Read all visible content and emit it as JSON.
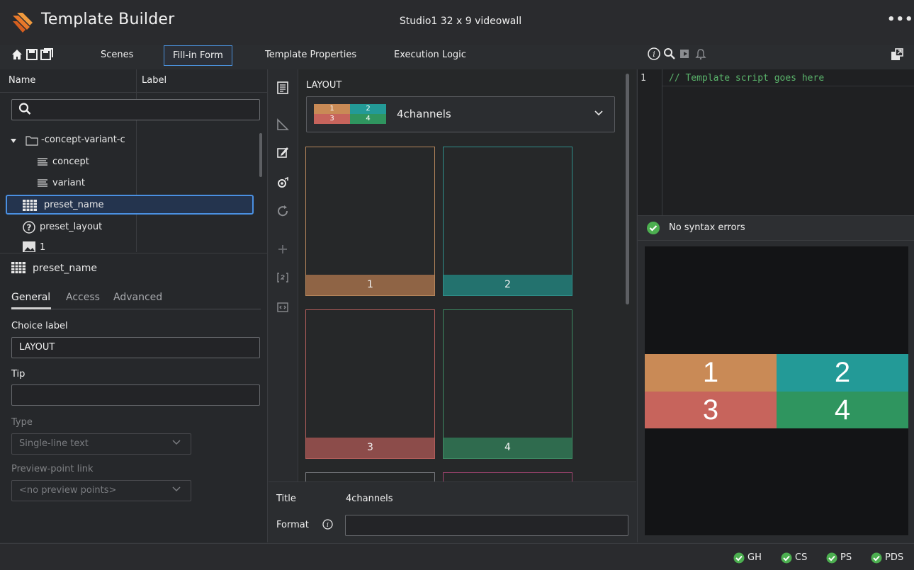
{
  "app": {
    "title": "Template Builder",
    "document_title": "Studio1 32 x 9 videowall",
    "more_label": "•••"
  },
  "toolbar": {
    "tabs": [
      "Scenes",
      "Fill-in Form",
      "Template Properties",
      "Execution Logic"
    ],
    "active_tab": "Fill-in Form"
  },
  "tree": {
    "columns": [
      "Name",
      "Label"
    ],
    "search_placeholder": "",
    "rows": [
      {
        "label": "-concept-variant-c",
        "icon": "folder-icon",
        "indent": 0
      },
      {
        "label": "concept",
        "icon": "text-lines-icon",
        "indent": 1
      },
      {
        "label": "variant",
        "icon": "text-lines-icon",
        "indent": 1
      },
      {
        "label": "preset_name",
        "icon": "grid-icon",
        "indent": 0,
        "selected": true
      },
      {
        "label": "preset_layout",
        "icon": "question-icon",
        "indent": 0
      },
      {
        "label": "1",
        "icon": "image-icon",
        "indent": 0
      }
    ]
  },
  "properties": {
    "field_name": "preset_name",
    "tabs": [
      "General",
      "Access",
      "Advanced"
    ],
    "active_tab": "General",
    "choice_label": "Choice label",
    "choice_value": "LAYOUT",
    "tip_label": "Tip",
    "tip_value": "",
    "type_label": "Type",
    "type_value": "Single-line text",
    "preview_link_label": "Preview-point link",
    "preview_link_value": "<no preview points>"
  },
  "layout_panel": {
    "heading": "LAYOUT",
    "selected": "4channels",
    "tiles": [
      {
        "label": "1",
        "color": "#8f6445",
        "border": "#b7875c"
      },
      {
        "label": "2",
        "color": "#23726e",
        "border": "#2f8f8a"
      },
      {
        "label": "3",
        "color": "#8c4c4a",
        "border": "#b35e5b"
      },
      {
        "label": "4",
        "color": "#2f6b4e",
        "border": "#3d8a63"
      }
    ],
    "title_label": "Title",
    "title_value": "4channels",
    "format_label": "Format",
    "format_value": ""
  },
  "script": {
    "line_number": "1",
    "code": "// Template script goes here",
    "syntax_status": "No syntax errors"
  },
  "preview": {
    "cells": [
      {
        "label": "1",
        "color": "#c98a56"
      },
      {
        "label": "2",
        "color": "#239a97"
      },
      {
        "label": "3",
        "color": "#c7645c"
      },
      {
        "label": "4",
        "color": "#2f955f"
      }
    ]
  },
  "status": {
    "items": [
      "GH",
      "CS",
      "PS",
      "PDS"
    ],
    "ok_color": "#4caf50"
  },
  "colors": {
    "accent": "#4a90e2",
    "logo": "#e8782a"
  }
}
